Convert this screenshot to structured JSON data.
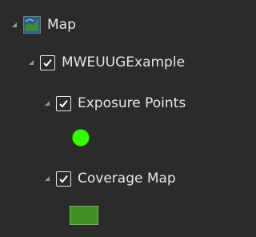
{
  "tree": {
    "root": {
      "label": "Map",
      "icon": "map-icon",
      "expanded": true
    },
    "layer": {
      "label": "MWEUUGExample",
      "checked": true,
      "expanded": true
    },
    "sublayers": [
      {
        "label": "Exposure Points",
        "checked": true,
        "expanded": true,
        "symbol": "green-circle-symbol",
        "symbol_color": "#33ff00"
      },
      {
        "label": "Coverage Map",
        "checked": true,
        "expanded": true,
        "symbol": "green-rectangle-symbol",
        "symbol_color": "#3f8f23"
      }
    ]
  },
  "colors": {
    "background": "#2b2b2b",
    "text": "#e6e6e6"
  }
}
